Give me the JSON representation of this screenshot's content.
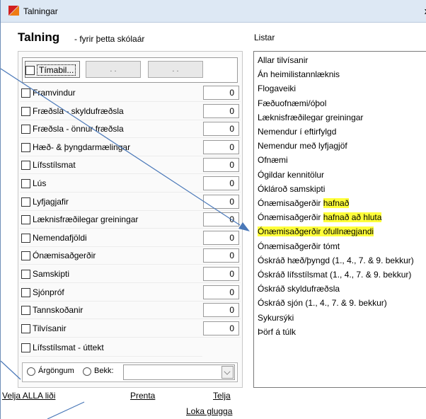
{
  "window": {
    "title": "Talningar",
    "close_glyph": "x"
  },
  "heading": {
    "title": "Talning",
    "subtitle": "- fyrir þetta skólaár"
  },
  "period": {
    "checkbox_label": "Tímabil...",
    "from_value": ". .",
    "to_value": ". ."
  },
  "counts": [
    {
      "label": "Framvindur",
      "value": "0"
    },
    {
      "label": "Fræðsla - skyldufræðsla",
      "value": "0"
    },
    {
      "label": "Fræðsla - önnur fræðsla",
      "value": "0"
    },
    {
      "label": "Hæð- & þyngdarmælingar",
      "value": "0"
    },
    {
      "label": "Lífsstílsmat",
      "value": "0"
    },
    {
      "label": "Lús",
      "value": "0"
    },
    {
      "label": "Lyfjagjafir",
      "value": "0"
    },
    {
      "label": "Læknisfræðilegar greiningar",
      "value": "0"
    },
    {
      "label": "Nemendafjöldi",
      "value": "0"
    },
    {
      "label": "Ónæmisaðgerðir",
      "value": "0"
    },
    {
      "label": "Samskipti",
      "value": "0"
    },
    {
      "label": "Sjónpróf",
      "value": "0"
    },
    {
      "label": "Tannskoðanir",
      "value": "0"
    },
    {
      "label": "Tilvísanir",
      "value": "0"
    }
  ],
  "extra_row": {
    "label": "Lífsstílsmat - úttekt"
  },
  "filter": {
    "radio_1": "Árgöngum",
    "radio_2": "Bekk:",
    "combo_value": ""
  },
  "actions": {
    "select_all": "Velja ALLA liði",
    "print": "Prenta",
    "count": "Telja",
    "close": "Loka glugga"
  },
  "lists": {
    "label": "Listar",
    "items": [
      {
        "text": "Allar tilvísanir",
        "hl": ""
      },
      {
        "text": "Án heimilistannlæknis",
        "hl": ""
      },
      {
        "text": "Flogaveiki",
        "hl": ""
      },
      {
        "text": "Fæðuofnæmi/óþol",
        "hl": ""
      },
      {
        "text": "Læknisfræðilegar greiningar",
        "hl": ""
      },
      {
        "text": "Nemendur í eftirfylgd",
        "hl": ""
      },
      {
        "text": "Nemendur með lyfjagjöf",
        "hl": ""
      },
      {
        "text": "Ofnæmi",
        "hl": ""
      },
      {
        "text": "Ógildar kennitölur",
        "hl": ""
      },
      {
        "text": "Óklároð samskipti",
        "hl": ""
      },
      {
        "text": "Ónæmisaðgerðir ",
        "hl": "hafnað"
      },
      {
        "text": "Ónæmisaðgerðir ",
        "hl": "hafnað að hluta"
      },
      {
        "text": "",
        "hl": "Ónæmisaðgerðir ófullnægjandi"
      },
      {
        "text": "Ónæmisaðgerðir tómt",
        "hl": ""
      },
      {
        "text": "Óskráð hæð/þyngd (1., 4., 7. & 9. bekkur)",
        "hl": ""
      },
      {
        "text": "Óskráð lífsstílsmat (1., 4., 7. & 9. bekkur)",
        "hl": ""
      },
      {
        "text": "Óskráð skyldufræðsla",
        "hl": ""
      },
      {
        "text": "Óskráð sjón (1., 4., 7. & 9. bekkur)",
        "hl": ""
      },
      {
        "text": "Sykursýki",
        "hl": ""
      },
      {
        "text": "Þörf á túlk",
        "hl": ""
      }
    ]
  },
  "colors": {
    "highlight": "#ffff3a",
    "arrow": "#4a78b8",
    "titlebar": "#dde8f4"
  }
}
